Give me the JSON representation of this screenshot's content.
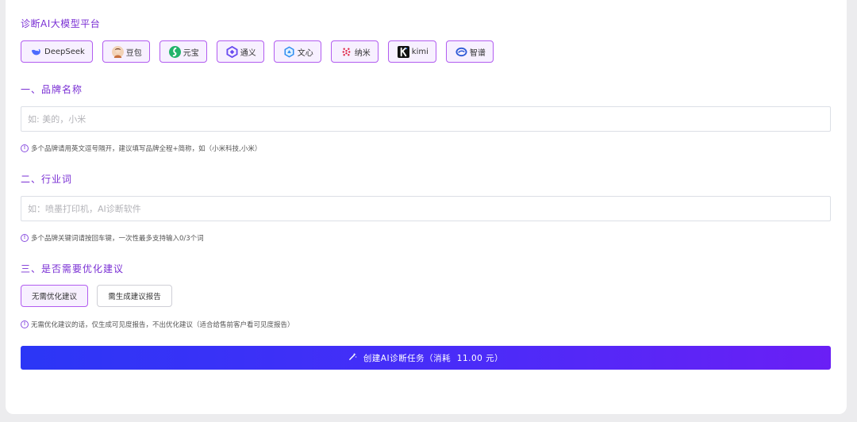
{
  "title": "诊断AI大模型平台",
  "platforms": [
    {
      "label": "DeepSeek",
      "icon": "deepseek-icon",
      "color": "#4d6bfe"
    },
    {
      "label": "豆包",
      "icon": "doubao-icon",
      "color": "#e59a6a"
    },
    {
      "label": "元宝",
      "icon": "yuanbao-icon",
      "color": "#22b36b"
    },
    {
      "label": "通义",
      "icon": "tongyi-icon",
      "color": "#6a4cf0"
    },
    {
      "label": "文心",
      "icon": "wenxin-icon",
      "color": "#2d8cf0"
    },
    {
      "label": "纳米",
      "icon": "nami-icon",
      "color": "#e02a4a"
    },
    {
      "label": "kimi",
      "icon": "kimi-icon",
      "color": "#111111"
    },
    {
      "label": "智谱",
      "icon": "zhipu-icon",
      "color": "#2f5bd6"
    }
  ],
  "brand": {
    "heading": "一、品牌名称",
    "placeholder": "如: 美的，小米",
    "value": "",
    "hint": "多个品牌请用英文逗号隔开，建议填写品牌全程+简称，如（小米科技,小米）"
  },
  "industry": {
    "heading": "二、行业词",
    "placeholder": "如：喷墨打印机，AI诊断软件",
    "value": "",
    "hint": "多个品牌关键词请按回车键，一次性最多支持输入0/3个词"
  },
  "optimize": {
    "heading": "三、是否需要优化建议",
    "options": [
      "无需优化建议",
      "需生成建议报告"
    ],
    "selected": "无需优化建议",
    "hint": "无需优化建议的话，仅生成可见度报告，不出优化建议（适合给售前客户看可见度报告）"
  },
  "submit": {
    "label": "创建AI诊断任务（消耗  11.00 元）",
    "icon": "magic-wand-icon"
  },
  "colors": {
    "accent": "#7a2fd4",
    "border_active": "#b25cf0",
    "button_gradient_start": "#2b36f6",
    "button_gradient_end": "#6a1ff5"
  }
}
